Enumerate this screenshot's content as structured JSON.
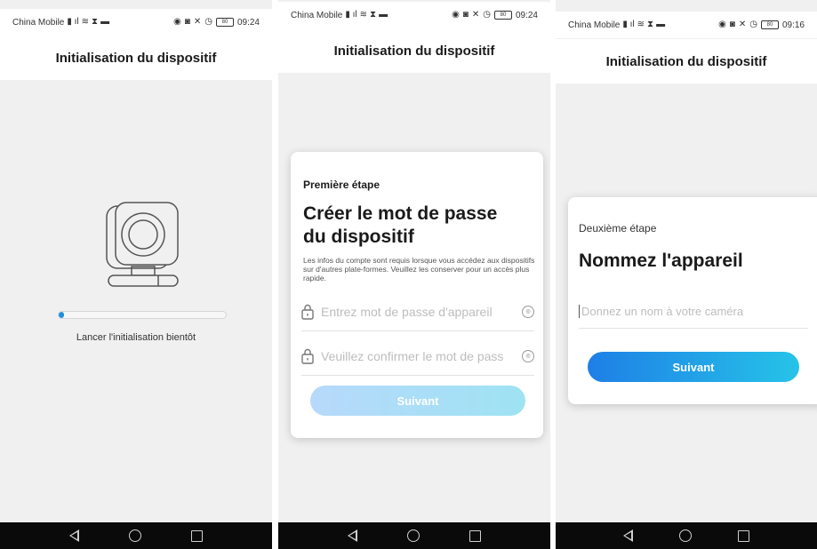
{
  "status_bar": {
    "carrier": "China Mobile",
    "battery": "80",
    "times": [
      "09:24",
      "09:24",
      "09:16"
    ]
  },
  "page_title": "Initialisation du dispositif",
  "screen1": {
    "progress": 0.03,
    "status_text": "Lancer l'initialisation bientôt"
  },
  "screen2": {
    "step_label": "Première étape",
    "title_line1": "Créer le mot de passe",
    "title_line2": "du dispositif",
    "description": "Les infos du compte sont requis lorsque vous accédez aux dispositifs sur d'autres plate-formes. Veuillez les conserver pour un accès plus rapide.",
    "password_placeholder": "Entrez mot de passe d'appareil",
    "confirm_placeholder": "Veuillez confirmer le mot de pass",
    "next_button": "Suivant"
  },
  "screen3": {
    "step_label": "Deuxième étape",
    "title": "Nommez l'appareil",
    "name_placeholder": "Donnez un nom à votre caméra",
    "next_button": "Suivant"
  },
  "icons": {
    "signal": "signal-icon",
    "wifi": "wifi-icon",
    "eye": "eye-icon",
    "lock": "lock-icon"
  },
  "colors": {
    "accent_start": "#1e7fe6",
    "accent_end": "#26c3e8",
    "disabled_start": "#b7d9fb",
    "disabled_end": "#9ee3f3",
    "progress": "#1f8fe0"
  }
}
